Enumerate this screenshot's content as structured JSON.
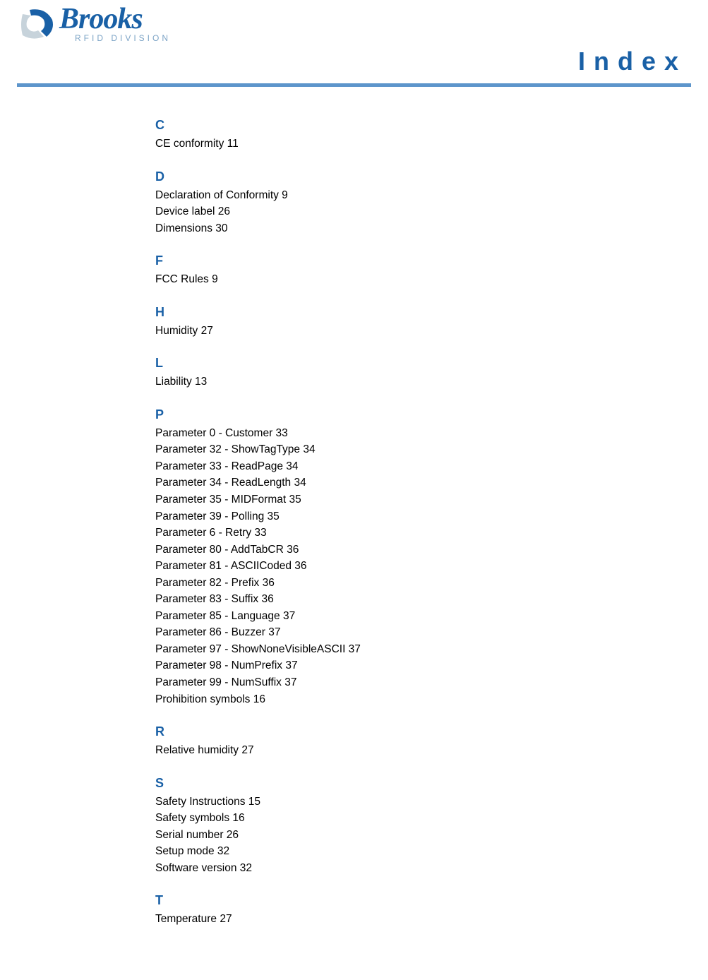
{
  "logo": {
    "brand": "Brooks",
    "sub": "RFID DIVISION"
  },
  "page_title": "Index",
  "sections": [
    {
      "letter": "C",
      "entries": [
        "CE conformity 11"
      ]
    },
    {
      "letter": "D",
      "entries": [
        "Declaration of Conformity 9",
        "Device label 26",
        "Dimensions 30"
      ]
    },
    {
      "letter": "F",
      "entries": [
        "FCC Rules 9"
      ]
    },
    {
      "letter": "H",
      "entries": [
        "Humidity 27"
      ]
    },
    {
      "letter": "L",
      "entries": [
        "Liability 13"
      ]
    },
    {
      "letter": "P",
      "entries": [
        "Parameter 0 - Customer 33",
        "Parameter 32 - ShowTagType 34",
        "Parameter 33 - ReadPage 34",
        "Parameter 34 - ReadLength 34",
        "Parameter 35 - MIDFormat 35",
        "Parameter 39 - Polling 35",
        "Parameter 6 - Retry 33",
        "Parameter 80 - AddTabCR 36",
        "Parameter 81 - ASCIICoded 36",
        "Parameter 82 - Prefix 36",
        "Parameter 83 - Suffix 36",
        "Parameter 85 - Language 37",
        "Parameter 86 - Buzzer 37",
        "Parameter 97 - ShowNoneVisibleASCII 37",
        "Parameter 98 - NumPrefix 37",
        "Parameter 99 - NumSuffix 37",
        "Prohibition symbols 16"
      ]
    },
    {
      "letter": "R",
      "entries": [
        "Relative humidity 27"
      ]
    },
    {
      "letter": "S",
      "entries": [
        "Safety Instructions 15",
        "Safety symbols 16",
        "Serial number 26",
        "Setup mode 32",
        "Software version 32"
      ]
    },
    {
      "letter": "T",
      "entries": [
        "Temperature 27"
      ]
    }
  ]
}
